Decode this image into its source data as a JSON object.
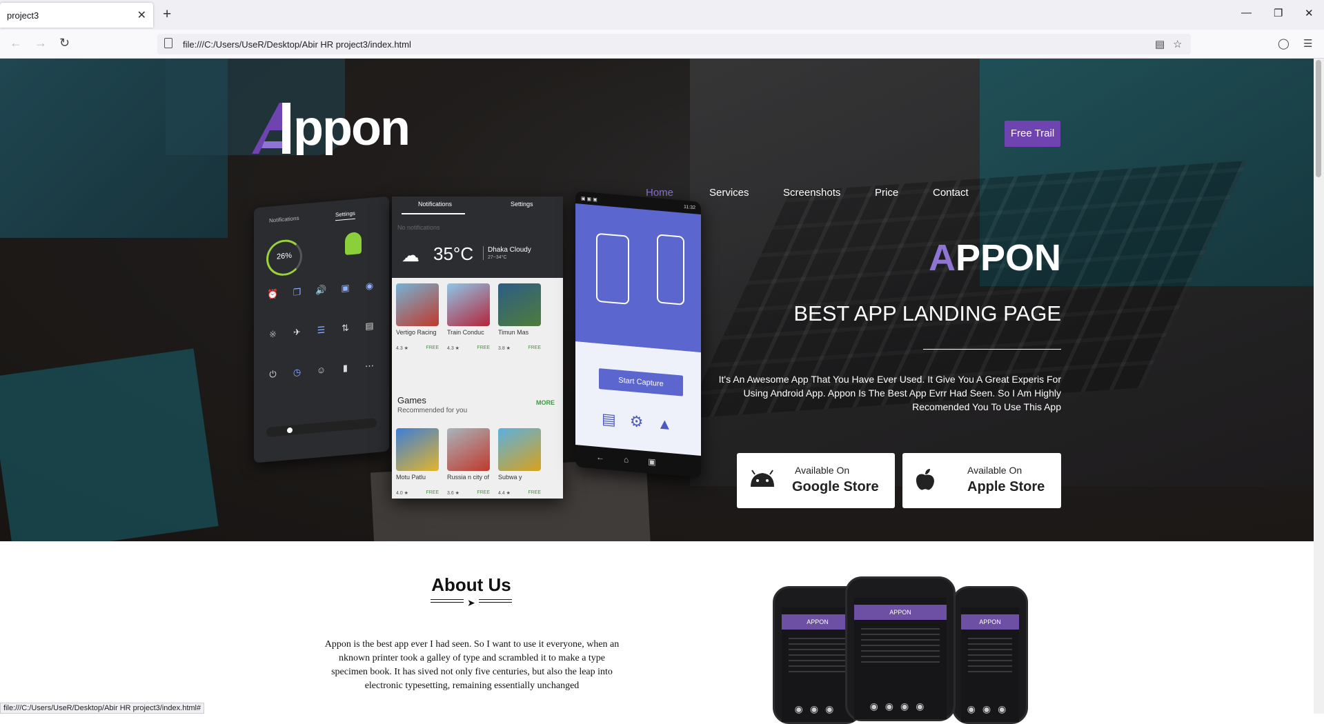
{
  "browser": {
    "tab_title": "project3",
    "tab_close": "✕",
    "new_tab": "+",
    "url": "file:///C:/Users/UseR/Desktop/Abir HR project3/index.html",
    "status_url": "file:///C:/Users/UseR/Desktop/Abir HR project3/index.html#"
  },
  "site": {
    "logo_text": "ppon",
    "nav": [
      "Home",
      "Services",
      "Screenshots",
      "Price",
      "Contact"
    ],
    "cta": "Free Trail"
  },
  "phone_a": {
    "tab1": "Notifications",
    "tab2": "Settings",
    "battery": "26%"
  },
  "phone_b": {
    "tab1": "Notifications",
    "tab2": "Settings",
    "no_notifications": "No notifications",
    "temp": "35°C",
    "city": "Dhaka Cloudy",
    "range": "27~34°C",
    "apps": [
      {
        "name": "Vertigo Racing",
        "rating": "4.3 ★",
        "price": "FREE",
        "color": "#c0392b"
      },
      {
        "name": "Train Conduc",
        "rating": "4.3 ★",
        "price": "FREE",
        "color": "#b3253a"
      },
      {
        "name": "Timun Mas",
        "rating": "3.8 ★",
        "price": "FREE",
        "color": "#4f7d3a"
      }
    ],
    "games_title": "Games",
    "games_sub": "Recommended for you",
    "more": "MORE",
    "games": [
      {
        "name": "Motu Patlu",
        "rating": "4.0 ★",
        "price": "FREE",
        "color": "#3d7ed6"
      },
      {
        "name": "Russia n city of",
        "rating": "3.6 ★",
        "price": "FREE",
        "color": "#8a9aa6"
      },
      {
        "name": "Subwa y",
        "rating": "4.4 ★",
        "price": "FREE",
        "color": "#d8a21b"
      }
    ]
  },
  "phone_c": {
    "time": "11:32",
    "capture": "Start Capture"
  },
  "hero": {
    "title_accent": "A",
    "title_rest": "PPON",
    "subtitle": "BEST APP LANDING PAGE",
    "description": "It's An Awesome App That You Have Ever Used. It Give You A Great Experis For Using Android App. Appon Is The Best App Evrr Had Seen. So I Am Highly Recomended You To Use This App",
    "google_small": "Available On",
    "google_big": "Google Store",
    "apple_small": "Available On",
    "apple_big": "Apple Store"
  },
  "about": {
    "title": "About Us",
    "text": "Appon is the best app ever I had seen. So I want to use it everyone, when an nknown printer took a galley of type and scrambled it to make a type specimen book. It has sived not only five centuries, but also the leap into electronic typesetting, remaining essentially unchanged"
  },
  "mockup": {
    "brand": "APPON"
  },
  "colors": {
    "accent": "#6f43b0",
    "accent_light": "#8f74d4"
  }
}
